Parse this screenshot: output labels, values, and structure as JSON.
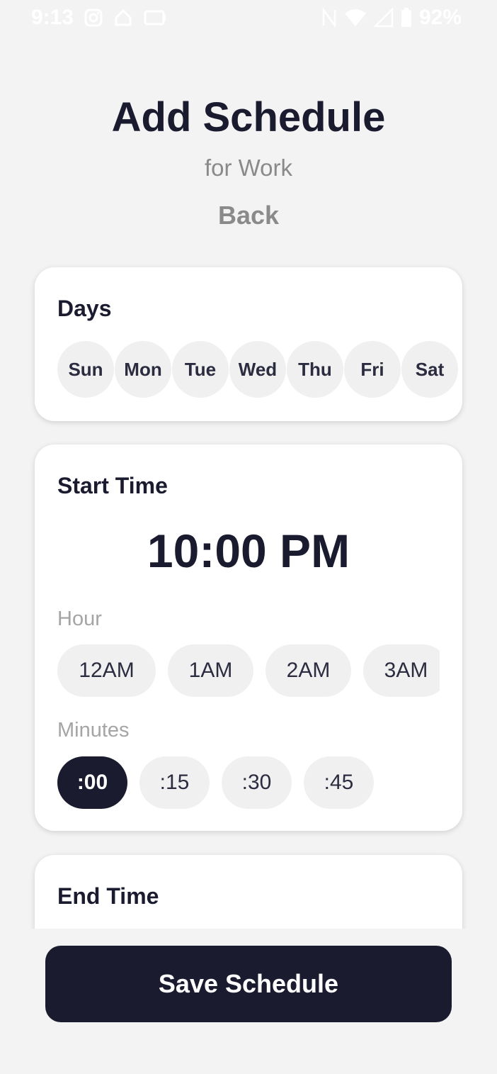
{
  "status_bar": {
    "time": "9:13",
    "battery": "92%",
    "left_icons": [
      "instagram-icon",
      "home-icon",
      "cast-icon"
    ],
    "right_icons": [
      "nfc-icon",
      "wifi-icon",
      "signal-icon",
      "battery-icon"
    ]
  },
  "header": {
    "title": "Add Schedule",
    "subtitle": "for Work",
    "back": "Back"
  },
  "days": {
    "title": "Days",
    "items": [
      "Sun",
      "Mon",
      "Tue",
      "Wed",
      "Thu",
      "Fri",
      "Sat"
    ]
  },
  "start_time": {
    "title": "Start Time",
    "value": "10:00 PM",
    "hour_label": "Hour",
    "hours": [
      "12AM",
      "1AM",
      "2AM",
      "3AM"
    ],
    "minutes_label": "Minutes",
    "minutes": [
      ":00",
      ":15",
      ":30",
      ":45"
    ],
    "selected_minute": ":00"
  },
  "end_time": {
    "title": "End Time"
  },
  "save_button": "Save Schedule",
  "colors": {
    "primary": "#1b1b30",
    "background": "#f3f3f3",
    "chip": "#f0f0f0",
    "muted": "#8a8a8a"
  }
}
